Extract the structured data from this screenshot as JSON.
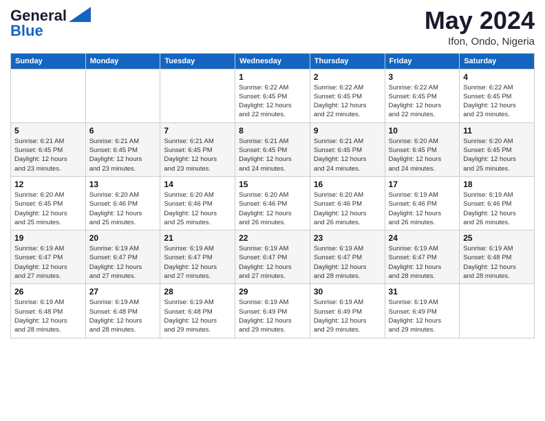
{
  "logo": {
    "line1": "General",
    "line2": "Blue"
  },
  "title": "May 2024",
  "location": "Ifon, Ondo, Nigeria",
  "weekdays": [
    "Sunday",
    "Monday",
    "Tuesday",
    "Wednesday",
    "Thursday",
    "Friday",
    "Saturday"
  ],
  "weeks": [
    [
      {
        "day": "",
        "info": ""
      },
      {
        "day": "",
        "info": ""
      },
      {
        "day": "",
        "info": ""
      },
      {
        "day": "1",
        "info": "Sunrise: 6:22 AM\nSunset: 6:45 PM\nDaylight: 12 hours\nand 22 minutes."
      },
      {
        "day": "2",
        "info": "Sunrise: 6:22 AM\nSunset: 6:45 PM\nDaylight: 12 hours\nand 22 minutes."
      },
      {
        "day": "3",
        "info": "Sunrise: 6:22 AM\nSunset: 6:45 PM\nDaylight: 12 hours\nand 22 minutes."
      },
      {
        "day": "4",
        "info": "Sunrise: 6:22 AM\nSunset: 6:45 PM\nDaylight: 12 hours\nand 23 minutes."
      }
    ],
    [
      {
        "day": "5",
        "info": "Sunrise: 6:21 AM\nSunset: 6:45 PM\nDaylight: 12 hours\nand 23 minutes."
      },
      {
        "day": "6",
        "info": "Sunrise: 6:21 AM\nSunset: 6:45 PM\nDaylight: 12 hours\nand 23 minutes."
      },
      {
        "day": "7",
        "info": "Sunrise: 6:21 AM\nSunset: 6:45 PM\nDaylight: 12 hours\nand 23 minutes."
      },
      {
        "day": "8",
        "info": "Sunrise: 6:21 AM\nSunset: 6:45 PM\nDaylight: 12 hours\nand 24 minutes."
      },
      {
        "day": "9",
        "info": "Sunrise: 6:21 AM\nSunset: 6:45 PM\nDaylight: 12 hours\nand 24 minutes."
      },
      {
        "day": "10",
        "info": "Sunrise: 6:20 AM\nSunset: 6:45 PM\nDaylight: 12 hours\nand 24 minutes."
      },
      {
        "day": "11",
        "info": "Sunrise: 6:20 AM\nSunset: 6:45 PM\nDaylight: 12 hours\nand 25 minutes."
      }
    ],
    [
      {
        "day": "12",
        "info": "Sunrise: 6:20 AM\nSunset: 6:45 PM\nDaylight: 12 hours\nand 25 minutes."
      },
      {
        "day": "13",
        "info": "Sunrise: 6:20 AM\nSunset: 6:46 PM\nDaylight: 12 hours\nand 25 minutes."
      },
      {
        "day": "14",
        "info": "Sunrise: 6:20 AM\nSunset: 6:46 PM\nDaylight: 12 hours\nand 25 minutes."
      },
      {
        "day": "15",
        "info": "Sunrise: 6:20 AM\nSunset: 6:46 PM\nDaylight: 12 hours\nand 26 minutes."
      },
      {
        "day": "16",
        "info": "Sunrise: 6:20 AM\nSunset: 6:46 PM\nDaylight: 12 hours\nand 26 minutes."
      },
      {
        "day": "17",
        "info": "Sunrise: 6:19 AM\nSunset: 6:46 PM\nDaylight: 12 hours\nand 26 minutes."
      },
      {
        "day": "18",
        "info": "Sunrise: 6:19 AM\nSunset: 6:46 PM\nDaylight: 12 hours\nand 26 minutes."
      }
    ],
    [
      {
        "day": "19",
        "info": "Sunrise: 6:19 AM\nSunset: 6:47 PM\nDaylight: 12 hours\nand 27 minutes."
      },
      {
        "day": "20",
        "info": "Sunrise: 6:19 AM\nSunset: 6:47 PM\nDaylight: 12 hours\nand 27 minutes."
      },
      {
        "day": "21",
        "info": "Sunrise: 6:19 AM\nSunset: 6:47 PM\nDaylight: 12 hours\nand 27 minutes."
      },
      {
        "day": "22",
        "info": "Sunrise: 6:19 AM\nSunset: 6:47 PM\nDaylight: 12 hours\nand 27 minutes."
      },
      {
        "day": "23",
        "info": "Sunrise: 6:19 AM\nSunset: 6:47 PM\nDaylight: 12 hours\nand 28 minutes."
      },
      {
        "day": "24",
        "info": "Sunrise: 6:19 AM\nSunset: 6:47 PM\nDaylight: 12 hours\nand 28 minutes."
      },
      {
        "day": "25",
        "info": "Sunrise: 6:19 AM\nSunset: 6:48 PM\nDaylight: 12 hours\nand 28 minutes."
      }
    ],
    [
      {
        "day": "26",
        "info": "Sunrise: 6:19 AM\nSunset: 6:48 PM\nDaylight: 12 hours\nand 28 minutes."
      },
      {
        "day": "27",
        "info": "Sunrise: 6:19 AM\nSunset: 6:48 PM\nDaylight: 12 hours\nand 28 minutes."
      },
      {
        "day": "28",
        "info": "Sunrise: 6:19 AM\nSunset: 6:48 PM\nDaylight: 12 hours\nand 29 minutes."
      },
      {
        "day": "29",
        "info": "Sunrise: 6:19 AM\nSunset: 6:49 PM\nDaylight: 12 hours\nand 29 minutes."
      },
      {
        "day": "30",
        "info": "Sunrise: 6:19 AM\nSunset: 6:49 PM\nDaylight: 12 hours\nand 29 minutes."
      },
      {
        "day": "31",
        "info": "Sunrise: 6:19 AM\nSunset: 6:49 PM\nDaylight: 12 hours\nand 29 minutes."
      },
      {
        "day": "",
        "info": ""
      }
    ]
  ]
}
